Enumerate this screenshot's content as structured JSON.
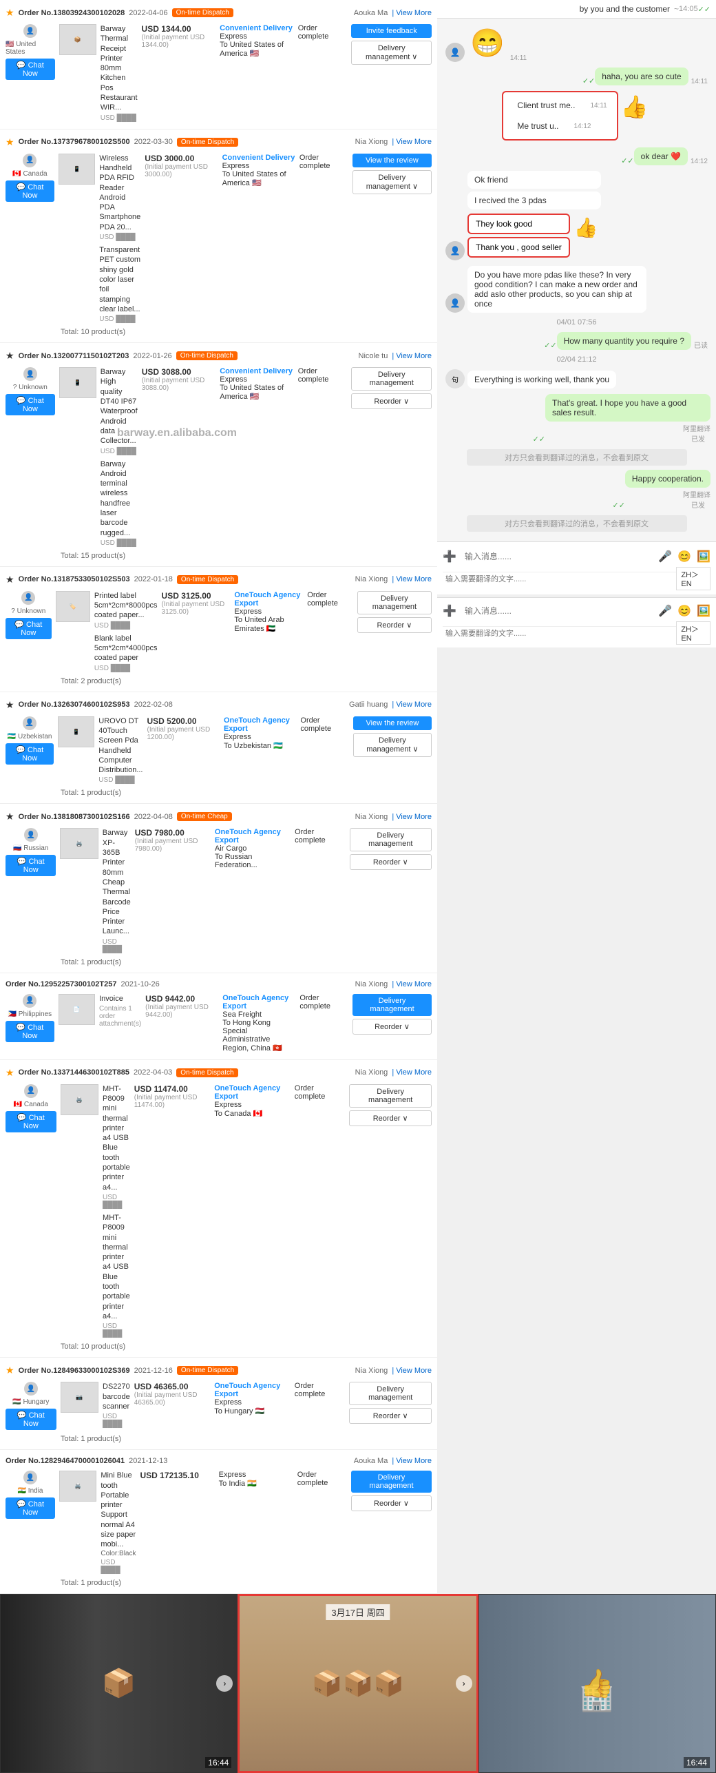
{
  "watermark": "barway.en.alibaba.com",
  "chat": {
    "header_text": "by you and the customer",
    "header_time": "14:05",
    "emoji_time": "14:11",
    "cute_msg": "haha, you are so cute",
    "cute_time": "14:11",
    "trust_bubble1": "Client trust me..",
    "trust_time1": "14:11",
    "trust_bubble2": "Me trust u..",
    "trust_time2": "14:12",
    "ok_dear": "ok dear ❤️",
    "ok_time": "14:12",
    "ok_friend": "Ok friend",
    "received": "I recived the 3 pdas",
    "look_good": "They look good",
    "good_seller": "Thank you , good seller",
    "do_you_have": "Do you have more pdas like these? In very good condition? I can make a new order and add aslo other products, so you can ship at once",
    "date_divider1": "04/01 07:56",
    "how_many": "How many quantity you require ?",
    "already_read1": "已读",
    "date_divider2": "02/04 21:12",
    "everything_working": "Everything is working well, thank you",
    "thats_great": "That's great. I hope you have a good sales result.",
    "translate_notice1": "阿里翻译",
    "already_read2": "已发",
    "translated_msg1": "对方只会看到翻译过的消息，不会看到原文",
    "happy_cooperation": "Happy cooperation.",
    "translate_notice2": "阿里翻译",
    "already_read3": "已发",
    "translated_msg2": "对方只会看到翻译过的消息，不会看到原文",
    "input_placeholder": "输入消息......",
    "translate_placeholder": "输入需要翻译的文字......",
    "zh_en": "ZH＞EN",
    "zh_en2": "ZH＞EN"
  },
  "orders": [
    {
      "order_no": "Order No.13803924300102028",
      "date": "2022-04-06",
      "dispatch": "On-time Dispatch",
      "customer": "Aouka Ma",
      "product1_name": "Barway Thermal Receipt Printer 80mm Kitchen Pos Restaurant WIR...",
      "product1_usd_label": "USD",
      "product1_price": "USD 1344.00",
      "product1_initial": "(Initial payment USD 1344.00)",
      "delivery_type": "Convenient Delivery",
      "delivery_method": "Express",
      "delivery_to": "To United States of America 🇺🇸",
      "status": "Order complete",
      "action1": "Invite feedback",
      "action2": "Delivery management ∨"
    },
    {
      "order_no": "Order No.13737967800102S500",
      "date": "2022-03-30",
      "dispatch": "On-time Dispatch",
      "customer": "Nia Xiong",
      "product1_name": "Wireless Handheld PDA RFID Reader Android PDA Smartphone PDA 20...",
      "product1_price": "USD 3000.00",
      "product1_initial": "(Initial payment USD 3000.00)",
      "product2_name": "Transparent PET custom shiny gold color laser foil stamping clear label...",
      "product2_usd": "USD",
      "delivery_type": "Convenient Delivery",
      "delivery_method": "Express",
      "delivery_to": "To United States of America 🇺🇸",
      "status": "Order complete",
      "action1": "View the review",
      "action2": "Delivery management ∨",
      "total": "Total: 10 product(s)"
    },
    {
      "order_no": "Order No.13200771150102T203",
      "date": "2022-01-26",
      "dispatch": "On-time Dispatch",
      "customer": "Nicole tu",
      "product1_name": "Barway High quality DT40 IP67 Waterproof Android data Collector...",
      "product1_price": "USD 3088.00",
      "product1_initial": "(Initial payment USD 3088.00)",
      "product2_name": "Barway Android terminal wireless handfree laser barcode rugged...",
      "product2_usd": "USD",
      "delivery_type": "Convenient Delivery",
      "delivery_method": "Express",
      "delivery_to": "To United States of America 🇺🇸",
      "status": "Order complete",
      "action1": "Delivery management",
      "action2": "Reorder ∨",
      "total": "Total: 15 product(s)"
    },
    {
      "order_no": "Order No.13187533050102S503",
      "date": "2022-01-18",
      "dispatch": "On-time Dispatch",
      "customer": "Nia Xiong",
      "product1_name": "Printed label 5cm*2cm*8000pcs coated paper...",
      "product1_price": "USD 3125.00",
      "product1_initial": "(Initial payment USD 3125.00)",
      "product2_name": "Blank label 5cm*2cm*4000pcs coated paper",
      "product2_usd": "USD",
      "delivery_type": "OneTouch Agency Export",
      "delivery_method": "Express",
      "delivery_to": "To United Arab Emirates 🇦🇪",
      "status": "Order complete",
      "action1": "Delivery management",
      "action2": "Reorder ∨",
      "total": "Total: 2 product(s)"
    },
    {
      "order_no": "Order No.13263074600102S953",
      "date": "2022-02-08",
      "dispatch": "",
      "customer": "Gatii huang",
      "product1_name": "UROVO DT 40Touch Screen Pda Handheld Computer Distribution...",
      "product1_price": "USD 5200.00",
      "product1_initial": "(Initial payment USD 1200.00)",
      "delivery_type": "OneTouch Agency Export",
      "delivery_method": "Express",
      "delivery_to": "To Uzbekistan 🇺🇿",
      "status": "Order complete",
      "action1": "View the review",
      "action2": "Delivery management ∨",
      "total": "Total: 1 product(s)"
    },
    {
      "order_no": "Order No.13818087300102S166",
      "date": "2022-04-08",
      "dispatch": "On-time Cheap",
      "customer": "Nia Xiong",
      "product1_name": "Barway XP-365B Printer 80mm Cheap Thermal Barcode Price Printer Launc...",
      "product1_price": "USD 7980.00",
      "product1_initial": "(Initial payment USD 7980.00)",
      "delivery_type": "OneTouch Agency Export",
      "delivery_method": "Air Cargo",
      "delivery_to": "To Russian Federation...",
      "status": "Order complete",
      "action1": "Delivery management",
      "action2": "Reorder ∨",
      "total": "Total: 1 product(s)"
    },
    {
      "order_no": "Order No.12952257300102T257",
      "date": "2021-10-26",
      "dispatch": "",
      "customer": "Nia Xiong",
      "product1_name": "Invoice",
      "product1_note": "Contains 1 order attachment(s)",
      "product1_price": "USD 9442.00",
      "product1_initial": "(Initial payment USD 9442.00)",
      "delivery_type": "OneTouch Agency Export",
      "delivery_method": "Sea Freight",
      "delivery_to": "To Hong Kong Special Administrative Region, China 🇭🇰",
      "status": "Order complete",
      "action1": "Delivery management",
      "action2": "Reorder ∨"
    },
    {
      "order_no": "Order No.13371446300102T885",
      "date": "2022-04-03",
      "dispatch": "On-time Dispatch",
      "customer": "Nia Xiong",
      "product1_name": "MHT-P8009 mini thermal printer a4 USB Blue tooth portable printer a4...",
      "product1_price": "USD 11474.00",
      "product1_initial": "(Initial payment USD 11474.00)",
      "product2_name": "MHT-P8009 mini thermal printer a4 USB Blue tooth portable printer a4...",
      "product2_usd": "USD",
      "delivery_type": "OneTouch Agency Export",
      "delivery_method": "Express",
      "delivery_to": "To Canada 🇨🇦",
      "status": "Order complete",
      "action1": "Delivery management",
      "action2": "Reorder ∨",
      "total": "Total: 10 product(s)"
    },
    {
      "order_no": "Order No.12849633000102S369",
      "date": "2021-12-16",
      "dispatch": "On-time Dispatch",
      "customer": "Nia Xiong",
      "product1_name": "DS2270 barcode scanner",
      "product1_price": "USD 46365.00",
      "product1_initial": "(Initial payment USD 46365.00)",
      "delivery_type": "OneTouch Agency Export",
      "delivery_method": "Express",
      "delivery_to": "To Hungary 🇭🇺",
      "status": "Order complete",
      "action1": "Delivery management",
      "action2": "Reorder ∨",
      "total": "Total: 1 product(s)"
    },
    {
      "order_no": "Order No.12829464700001026041",
      "date": "2021-12-13",
      "dispatch": "",
      "customer": "Aouka Ma",
      "product1_name": "Mini Blue tooth Portable printer Support normal A4 size paper mobi...",
      "product1_note": "Color:Black",
      "product1_price": "USD 172135.10",
      "delivery_type": "Express",
      "delivery_to": "To India 🇮🇳",
      "status": "Order complete",
      "action1": "Delivery management",
      "action2": "Reorder ∨",
      "total": "Total: 1 product(s)"
    }
  ],
  "bottom_images": [
    {
      "time": "16:44",
      "side": "left"
    },
    {
      "date_stamp": "3月17日 周四",
      "side": "middle"
    },
    {
      "time": "16:44",
      "side": "right"
    }
  ]
}
